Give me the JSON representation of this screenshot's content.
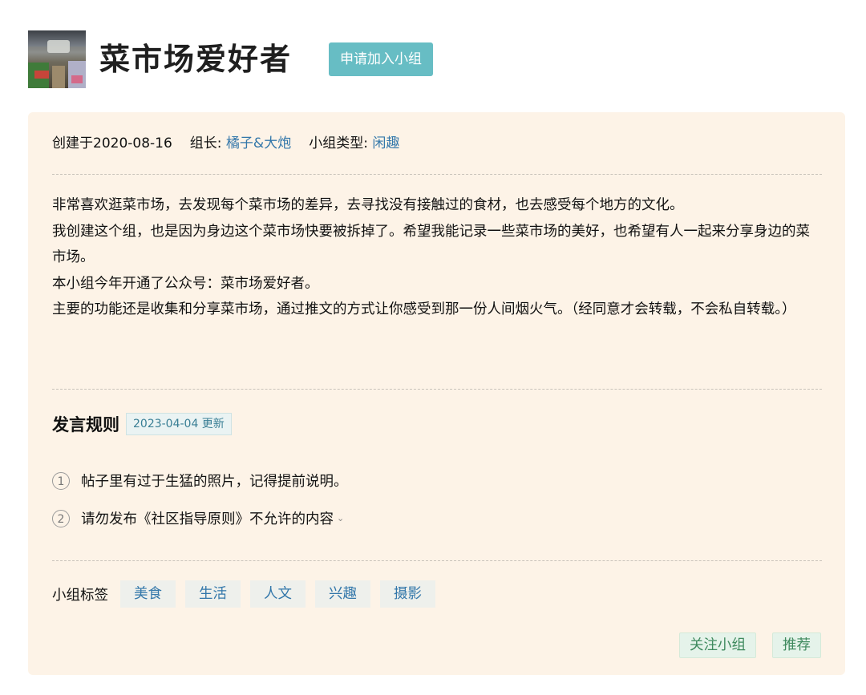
{
  "group": {
    "title": "菜市场爱好者",
    "join_label": "申请加入小组",
    "avatar_icon": "market-photo-avatar"
  },
  "meta": {
    "created": "创建于2020-08-16",
    "leader_label": "组长:",
    "leader_name": "橘子&大炮",
    "type_label": "小组类型:",
    "type_value": "闲趣"
  },
  "description": [
    "非常喜欢逛菜市场，去发现每个菜市场的差异，去寻找没有接触过的食材，也去感受每个地方的文化。",
    "我创建这个组，也是因为身边这个菜市场快要被拆掉了。希望我能记录一些菜市场的美好，也希望有人一起来分享身边的菜市场。",
    "本小组今年开通了公众号：菜市场爱好者。",
    "主要的功能还是收集和分享菜市场，通过推文的方式让你感受到那一份人间烟火气。（经同意才会转载，不会私自转载。）"
  ],
  "rules": {
    "title": "发言规则",
    "updated": "2023-04-04 更新",
    "items": [
      {
        "num": "1",
        "text": "帖子里有过于生猛的照片，记得提前说明。"
      },
      {
        "num": "2",
        "text": "请勿发布《社区指导原则》不允许的内容"
      }
    ]
  },
  "tags": {
    "label": "小组标签",
    "items": [
      "美食",
      "生活",
      "人文",
      "兴趣",
      "摄影"
    ]
  },
  "actions": {
    "follow_label": "关注小组",
    "recommend_label": "推荐"
  },
  "colors": {
    "accent": "#67bdc4",
    "card_bg": "#fdf3e7",
    "link": "#3377aa",
    "action_green": "#3f8a5e"
  }
}
